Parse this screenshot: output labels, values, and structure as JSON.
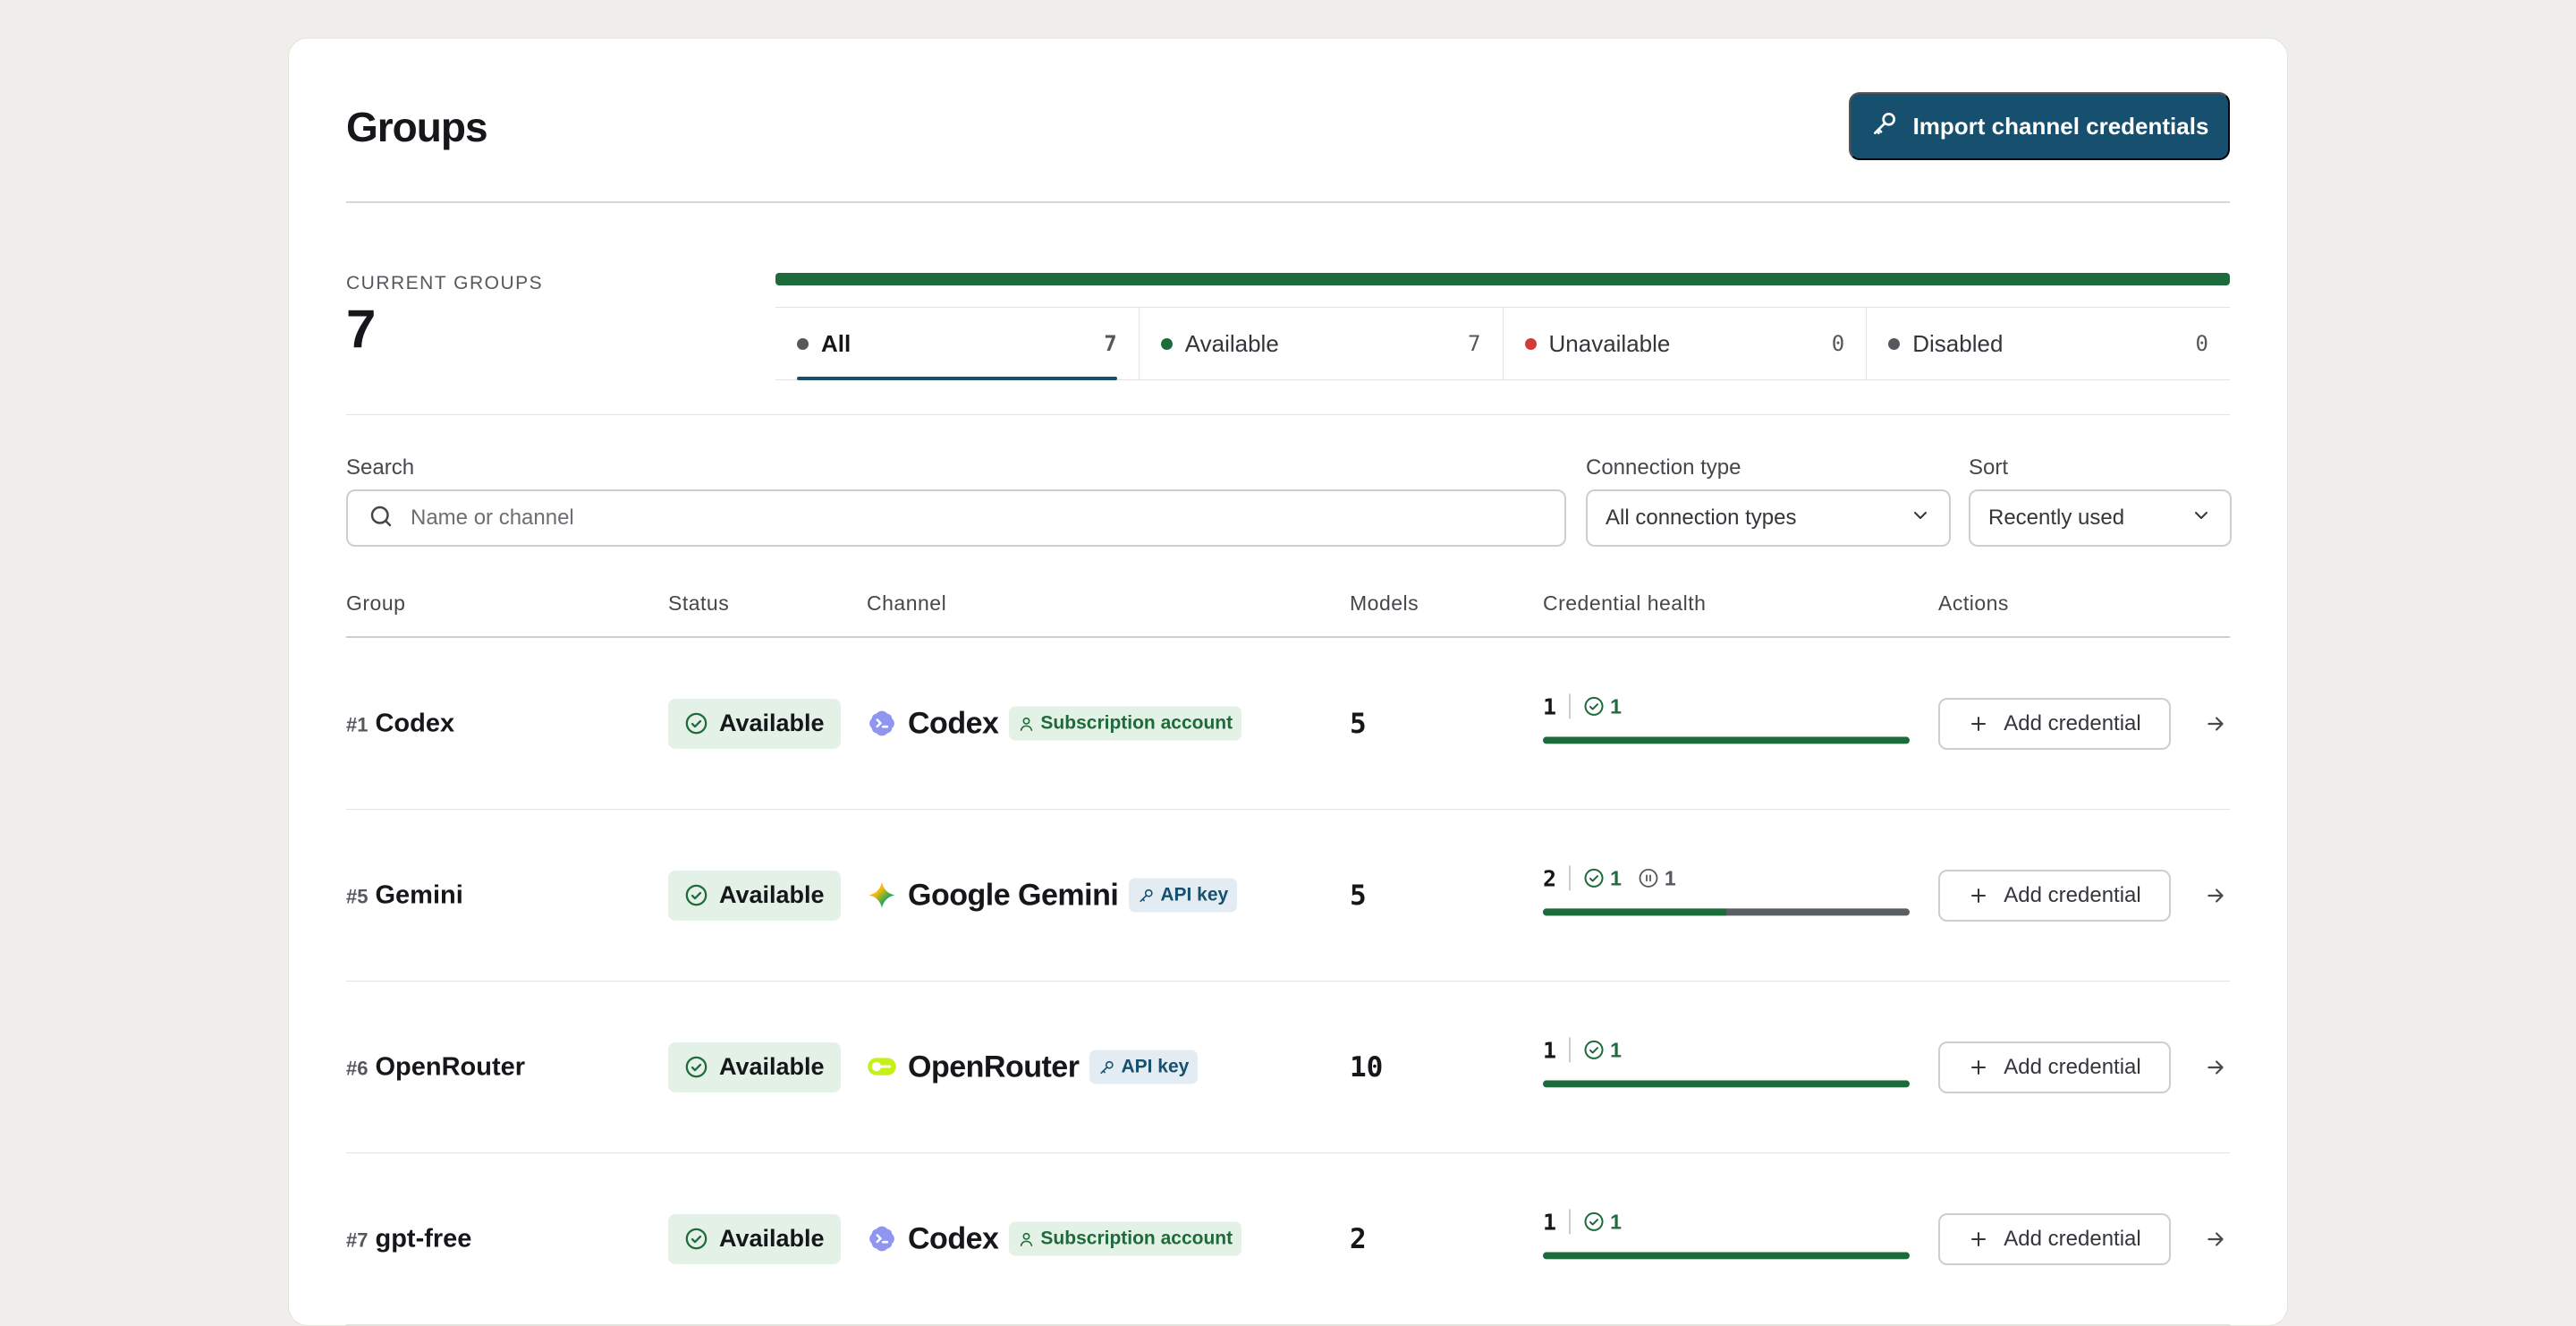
{
  "header": {
    "title": "Groups",
    "import_label": "Import channel credentials"
  },
  "summary": {
    "current_label": "CURRENT GROUPS",
    "current_count": "7",
    "tabs": [
      {
        "label": "All",
        "count": "7",
        "dot": "#55585c",
        "active": true
      },
      {
        "label": "Available",
        "count": "7",
        "dot": "#1d6b3b",
        "active": false
      },
      {
        "label": "Unavailable",
        "count": "0",
        "dot": "#d33a3a",
        "active": false
      },
      {
        "label": "Disabled",
        "count": "0",
        "dot": "#55585c",
        "active": false
      }
    ]
  },
  "filters": {
    "search_label": "Search",
    "search_placeholder": "Name or channel",
    "connection_label": "Connection type",
    "connection_value": "All connection types",
    "sort_label": "Sort",
    "sort_value": "Recently used"
  },
  "table": {
    "columns": [
      "Group",
      "Status",
      "Channel",
      "Models",
      "Credential health",
      "Actions"
    ],
    "add_label": "Add credential",
    "rows": [
      {
        "num": "#1",
        "name": "Codex",
        "status": "Available",
        "channel": "Codex",
        "logo": "codex-logo",
        "conn": "Subscription account",
        "conn_type": "sub",
        "models": "5",
        "total": "1",
        "ok": "1",
        "paused": null,
        "health_fraction": 1.0
      },
      {
        "num": "#5",
        "name": "Gemini",
        "status": "Available",
        "channel": "Google Gemini",
        "logo": "gemini-logo",
        "conn": "API key",
        "conn_type": "api",
        "models": "5",
        "total": "2",
        "ok": "1",
        "paused": "1",
        "health_fraction": 0.5
      },
      {
        "num": "#6",
        "name": "OpenRouter",
        "status": "Available",
        "channel": "OpenRouter",
        "logo": "openrouter-logo",
        "conn": "API key",
        "conn_type": "api",
        "models": "10",
        "total": "1",
        "ok": "1",
        "paused": null,
        "health_fraction": 1.0
      },
      {
        "num": "#7",
        "name": "gpt-free",
        "status": "Available",
        "channel": "Codex",
        "logo": "codex-logo",
        "conn": "Subscription account",
        "conn_type": "sub",
        "models": "2",
        "total": "1",
        "ok": "1",
        "paused": null,
        "health_fraction": 1.0
      }
    ]
  },
  "colors": {
    "accent": "#17506e",
    "success": "#1d6b3b",
    "danger": "#d33a3a",
    "neutral": "#55585c"
  }
}
